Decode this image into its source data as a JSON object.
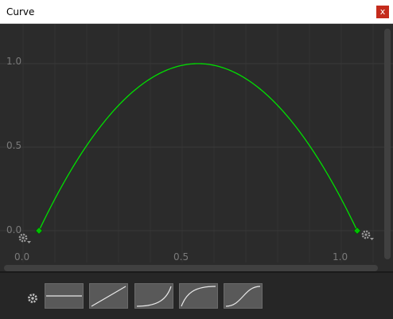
{
  "window": {
    "title": "Curve",
    "close_glyph": "x"
  },
  "axis": {
    "y_ticks": [
      "1.0",
      "0.5",
      "0.0"
    ],
    "x_ticks": [
      "0.0",
      "0.5",
      "1.0"
    ]
  },
  "colors": {
    "curve": "#00e000",
    "key": "#00c000",
    "close": "#c42b1c",
    "background": "#2b2b2b"
  },
  "curve": {
    "type": "parabola",
    "keys": [
      {
        "t": 0.05,
        "v": 0.0
      },
      {
        "t": 1.05,
        "v": 0.0
      }
    ],
    "peak": {
      "t": 0.55,
      "v": 1.0
    }
  },
  "icons": {
    "left_key_settings": "gear-dropdown-icon",
    "right_key_settings": "gear-dropdown-icon",
    "presets_settings": "gear-icon"
  },
  "presets": [
    {
      "name": "constant"
    },
    {
      "name": "linear"
    },
    {
      "name": "ease-in"
    },
    {
      "name": "ease-out"
    },
    {
      "name": "ease-in-out"
    }
  ]
}
